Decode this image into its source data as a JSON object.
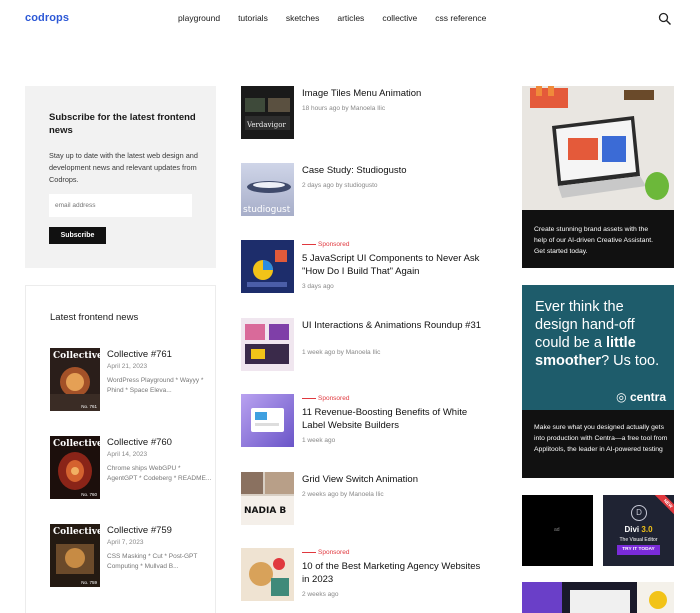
{
  "header": {
    "logo": "codrops",
    "nav": [
      "playground",
      "tutorials",
      "sketches",
      "articles",
      "collective",
      "css reference"
    ]
  },
  "subscribe": {
    "title": "Subscribe for the latest frontend news",
    "description": "Stay up to date with the latest web design and development news and relevant updates from Codrops.",
    "email_placeholder": "email address",
    "button": "Subscribe"
  },
  "latest": {
    "title": "Latest frontend news",
    "items": [
      {
        "cover": "Collective",
        "number": "No. 761",
        "title": "Collective #761",
        "date": "April 21, 2023",
        "summary": "WordPress Playground * Wayyy * Phind * Space Eleva..."
      },
      {
        "cover": "Collective",
        "number": "No. 760",
        "title": "Collective #760",
        "date": "April 14, 2023",
        "summary": "Chrome ships WebGPU * AgentGPT * Codeberg * README..."
      },
      {
        "cover": "Collective",
        "number": "No. 759",
        "title": "Collective #759",
        "date": "April 7, 2023",
        "summary": "CSS Masking * Cut * Post-GPT Computing * Mullvad B..."
      }
    ]
  },
  "articles": [
    {
      "sponsored": "",
      "title": "Image Tiles Menu Animation",
      "meta": "18 hours ago by Manoela Ilic",
      "thumb_label": "Verdavigor"
    },
    {
      "sponsored": "",
      "title": "Case Study: Studiogusto",
      "meta": "2 days ago by studiogusto",
      "thumb_label": "studiogust"
    },
    {
      "sponsored": "Sponsored",
      "title": "5 JavaScript UI Components to Never Ask \"How Do I Build That\" Again",
      "meta": "3 days ago",
      "thumb_label": ""
    },
    {
      "sponsored": "",
      "title": "UI Interactions & Animations Roundup #31",
      "meta": "1 week ago by Manoela Ilic",
      "thumb_label": ""
    },
    {
      "sponsored": "Sponsored",
      "title": "11 Revenue-Boosting Benefits of White Label Website Builders",
      "meta": "1 week ago",
      "thumb_label": ""
    },
    {
      "sponsored": "",
      "title": "Grid View Switch Animation",
      "meta": "2 weeks ago by Manoela Ilic",
      "thumb_label": "NADIA B"
    },
    {
      "sponsored": "Sponsored",
      "title": "10 of the Best Marketing Agency Websites in 2023",
      "meta": "2 weeks ago",
      "thumb_label": ""
    }
  ],
  "ads": {
    "ad1_caption": "Create stunning brand assets with the help of our AI-driven Creative Assistant. Get started today.",
    "ad2_head_1": "Ever think the design hand-off could be a",
    "ad2_head_bold": "little smoother",
    "ad2_head_2": "? Us too.",
    "ad2_brand": "centra",
    "ad2_caption": "Make sure what you designed actually gets into production with Centra—a free tool from Applitools, the leader in AI-powered testing",
    "ad3_label": "ad",
    "ad4_new": "NEW",
    "ad4_title": "Divi",
    "ad4_version": "3.0",
    "ad4_sub": "The Visual Editor",
    "ad4_button": "TRY IT TODAY"
  },
  "colors": {
    "brand": "#2c58d6",
    "sponsored": "#e0383e"
  }
}
